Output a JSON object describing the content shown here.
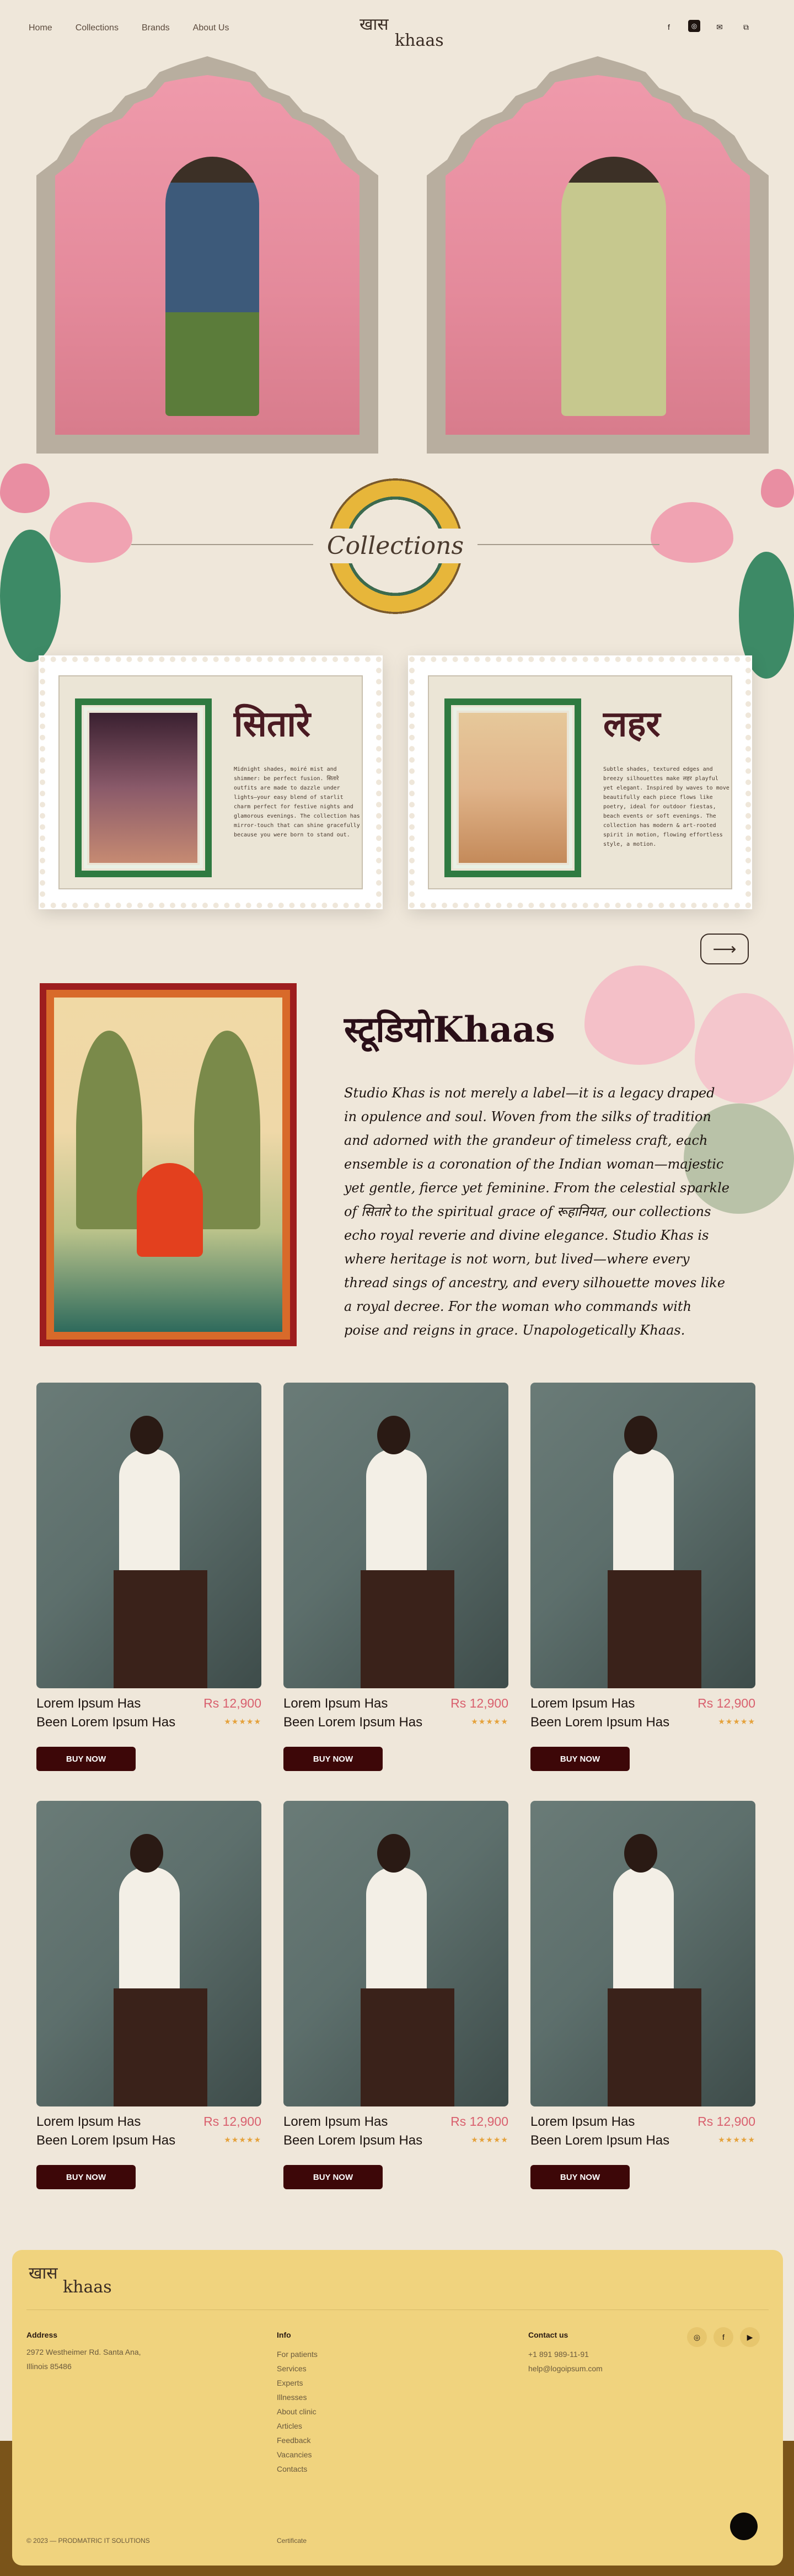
{
  "nav": {
    "links": [
      "Home",
      "Collections",
      "Brands",
      "About Us"
    ],
    "logo_dev": "खास",
    "logo_lat": "khaas",
    "social": [
      "facebook-icon",
      "instagram-icon",
      "mail-icon",
      "share-icon"
    ]
  },
  "collections": {
    "title": "Collections",
    "stamps": [
      {
        "name": "सितारे",
        "desc": "Midnight shades, moiré mist and shimmer: be perfect fusion. सितारे outfits are made to dazzle under lights—your easy blend of starlit charm perfect for festive nights and glamorous evenings. The collection has mirror-touch that can shine gracefully because you were born to stand out."
      },
      {
        "name": "लहर",
        "desc": "Subtle shades, textured edges and breezy silhouettes make लहर playful yet elegant. Inspired by waves to move beautifully each piece flows like poetry, ideal for outdoor fiestas, beach events or soft evenings. The collection has modern & art-rooted spirit in motion, flowing effortless style, a motion."
      }
    ],
    "next_arrow": "⟶"
  },
  "about": {
    "title": "स्टूडियोKhaas",
    "paragraph": "Studio Khas is not merely a label—it is a legacy draped in opulence and soul. Woven from the silks of tradition and adorned with the grandeur of timeless craft, each ensemble is a coronation of the Indian woman—majestic yet gentle, fierce yet feminine. From the celestial sparkle of सितारे to the spiritual grace of रूहानियत, our collections echo royal reverie and divine elegance. Studio Khas is where heritage is not worn, but lived—where every thread sings of ancestry, and every silhouette moves like a royal decree. For the woman who commands with poise and reigns in grace. Unapologetically Khaas."
  },
  "products": [
    {
      "line1": "Lorem Ipsum Has",
      "line2": "Been Lorem Ipsum Has",
      "price": "Rs 12,900",
      "rating": 5,
      "buy": "BUY NOW"
    },
    {
      "line1": "Lorem Ipsum Has",
      "line2": "Been Lorem Ipsum Has",
      "price": "Rs 12,900",
      "rating": 5,
      "buy": "BUY NOW"
    },
    {
      "line1": "Lorem Ipsum Has",
      "line2": "Been Lorem Ipsum Has",
      "price": "Rs 12,900",
      "rating": 5,
      "buy": "BUY NOW"
    },
    {
      "line1": "Lorem Ipsum Has",
      "line2": "Been Lorem Ipsum Has",
      "price": "Rs 12,900",
      "rating": 5,
      "buy": "BUY NOW"
    },
    {
      "line1": "Lorem Ipsum Has",
      "line2": "Been Lorem Ipsum Has",
      "price": "Rs 12,900",
      "rating": 5,
      "buy": "BUY NOW"
    },
    {
      "line1": "Lorem Ipsum Has",
      "line2": "Been Lorem Ipsum Has",
      "price": "Rs 12,900",
      "rating": 5,
      "buy": "BUY NOW"
    }
  ],
  "stars": "★★★★★",
  "footer": {
    "logo_dev": "खास",
    "logo_lat": "khaas",
    "address_title": "Address",
    "address_lines": [
      "2972 Westheimer Rd. Santa Ana,",
      "Illinois 85486"
    ],
    "info_title": "Info",
    "info_links": [
      "For patients",
      "Services",
      "Experts",
      "Illnesses",
      "About clinic",
      "Articles",
      "Feedback",
      "Vacancies",
      "Contacts"
    ],
    "contact_title": "Contact us",
    "contact_lines": [
      "+1 891 989-11-91",
      "help@logoipsum.com"
    ],
    "social": [
      "instagram-icon",
      "facebook-icon",
      "youtube-icon"
    ],
    "copyright": "© 2023 — PRODMATRIC IT SOLUTIONS",
    "certificate": "Certificate"
  },
  "colors": {
    "accent_pink": "#d9606e",
    "buy_button": "#3d0708",
    "footer_bg": "#f0d37e",
    "stamp_frame": "#2f7a41"
  }
}
